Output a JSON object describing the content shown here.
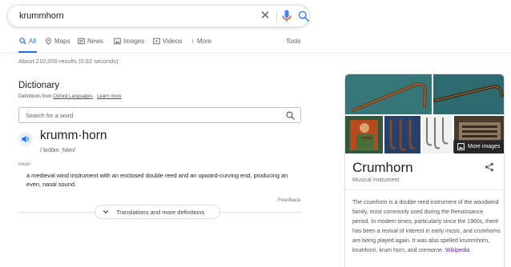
{
  "search": {
    "query": "krummhorn"
  },
  "tabs": [
    {
      "label": "All",
      "icon": "search-icon"
    },
    {
      "label": "Maps",
      "icon": "map-pin-icon"
    },
    {
      "label": "News",
      "icon": "news-icon"
    },
    {
      "label": "Images",
      "icon": "image-icon"
    },
    {
      "label": "Videos",
      "icon": "video-icon"
    },
    {
      "label": "More",
      "icon": "more-vert-icon"
    }
  ],
  "tools_label": "Tools",
  "result_stats": "About 210,000 results (0.92 seconds)",
  "dictionary": {
    "title": "Dictionary",
    "source_prefix": "Definitions from ",
    "source_name": "Oxford Languages",
    "source_sep": " · ",
    "learn_more": "Learn more",
    "search_placeholder": "Search for a word",
    "headword": "krumm·horn",
    "phonetic": "/ˈkro͝om ˌhôrn/",
    "part_of_speech": "noun",
    "definition": "a medieval wind instrument with an enclosed double reed and an upward-curving end, producing an even, nasal sound.",
    "feedback": "Feedback",
    "translations_label": "Translations and more definitions"
  },
  "knowledge_panel": {
    "more_images_label": "More images",
    "title": "Crumhorn",
    "subtitle": "Musical instrument",
    "description": "The crumhorn is a double reed instrument of the woodwind family, most commonly used during the Renaissance period. In modern times, particularly since the 1960s, there has been a revival of interest in early music, and crumhorns are being played again. It was also spelled krummhorn, krumhorn, krum horn, and cremorne.",
    "link": "Wikipedia"
  },
  "colors": {
    "accent": "#1a73e8",
    "mic_blue": "#4285f4",
    "mic_red": "#ea4335",
    "link_visited": "#681da8"
  }
}
